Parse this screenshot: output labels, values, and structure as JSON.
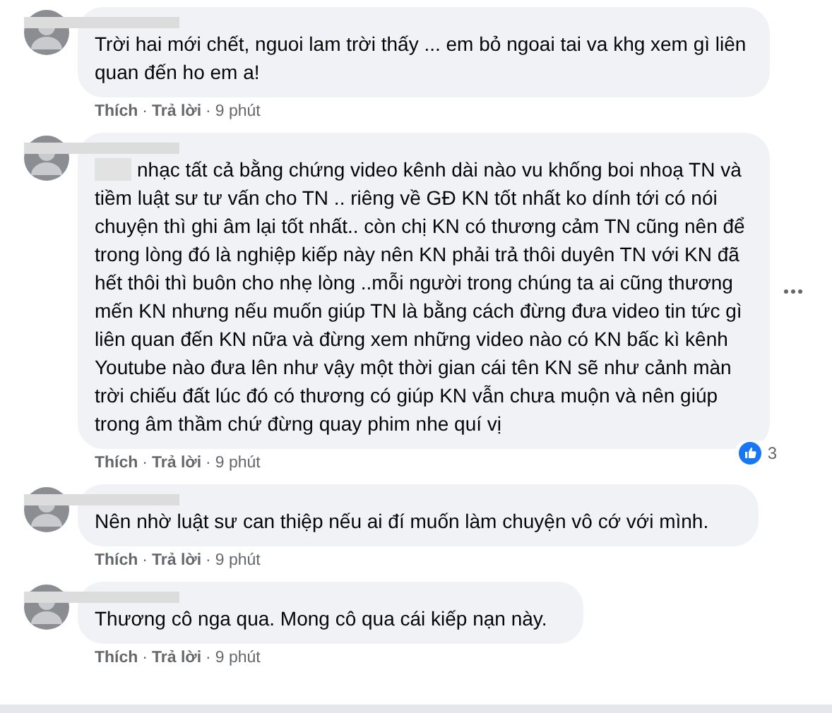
{
  "comments": [
    {
      "text": "Trời hai mới chết, nguoi lam trời thấy ... em bỏ ngoai tai va khg xem gì liên quan đến ho em a!",
      "actions": [
        {
          "kind": "link",
          "text": "Thích"
        },
        {
          "kind": "sep",
          "text": "·"
        },
        {
          "kind": "link",
          "text": "Trả lời"
        },
        {
          "kind": "sep",
          "text": "·"
        },
        {
          "kind": "time",
          "text": "9 phút"
        }
      ],
      "more": false
    },
    {
      "text": "nhạc tất cả bằng chứng video kênh dài nào vu khống boi nhoạ TN và tiềm luật sư tư vấn cho TN .. riêng về GĐ KN tốt nhất ko dính tới có nói chuyện thì ghi âm lại tốt nhất.. còn chị KN có thương cảm TN cũng nên để trong lòng đó là nghiệp kiếp này nên KN phải trả thôi duyên TN với KN đã hết thôi thì buôn cho nhẹ lòng ..mỗi người trong chúng ta ai cũng thương mến KN nhưng nếu muốn giúp TN là bằng cách đừng đưa video tin tức gì liên quan đến KN nữa và đừng xem những video nào có KN bấc kì kênh Youtube nào đưa lên như vậy một thời gian cái tên KN sẽ như cảnh màn trời chiếu đất lúc đó có thương có giúp KN vẫn chưa muộn và nên giúp trong âm thầm chứ đừng quay phim nhe quí vị",
      "actions": [
        {
          "kind": "link",
          "text": "Thích"
        },
        {
          "kind": "sep",
          "text": "·"
        },
        {
          "kind": "link",
          "text": "Trả lời"
        },
        {
          "kind": "sep",
          "text": "·"
        },
        {
          "kind": "time",
          "text": "9 phút"
        }
      ],
      "reactions": "3",
      "more": true
    },
    {
      "text": "Nên nhờ luật sư can thiệp nếu ai đí muốn làm chuyện vô cớ với mình.",
      "actions": [
        {
          "kind": "link",
          "text": "Thích"
        },
        {
          "kind": "sep",
          "text": "·"
        },
        {
          "kind": "link",
          "text": "Trả lời"
        },
        {
          "kind": "sep",
          "text": "·"
        },
        {
          "kind": "time",
          "text": "9 phút"
        }
      ],
      "more": false
    },
    {
      "text": "Thương cô nga qua. Mong cô qua cái kiếp nạn này.",
      "actions": [
        {
          "kind": "link",
          "text": "Thích"
        },
        {
          "kind": "sep",
          "text": "·"
        },
        {
          "kind": "link",
          "text": "Trả lời"
        },
        {
          "kind": "sep",
          "text": "·"
        },
        {
          "kind": "time",
          "text": "9 phút"
        }
      ],
      "more": false
    }
  ]
}
